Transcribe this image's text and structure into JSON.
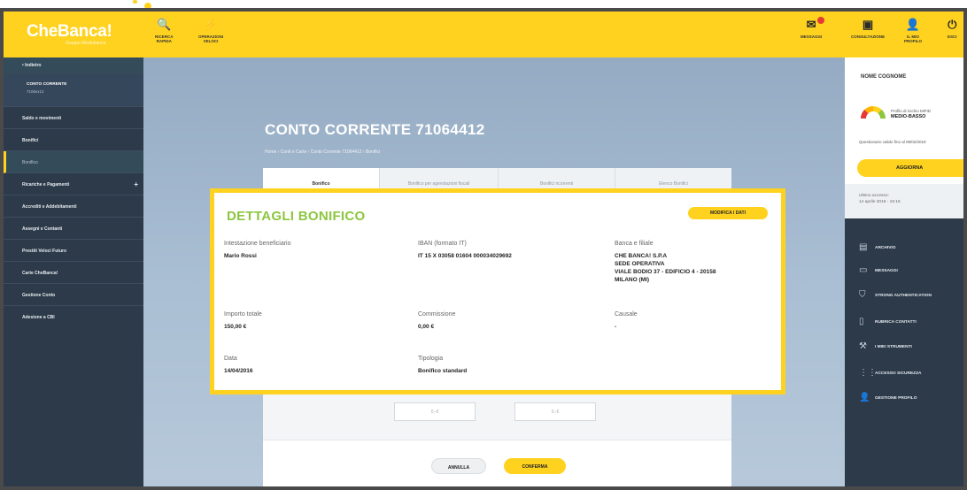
{
  "header": {
    "logo": "CheBanca!",
    "logo_sub": "Gruppo Mediobanca",
    "left_buttons": [
      {
        "icon": "search-icon",
        "glyph": "🔍",
        "label1": "RICERCA",
        "label2": "RAPIDA"
      },
      {
        "icon": "lightning-icon",
        "glyph": "⚡",
        "label1": "OPERAZIONI",
        "label2": "VELOCI"
      }
    ],
    "right_buttons": [
      {
        "icon": "mail-icon",
        "glyph": "✉",
        "label1": "MESSAGGI",
        "label2": ""
      },
      {
        "icon": "book-icon",
        "glyph": "▣",
        "label1": "CONSULTAZIONE",
        "label2": ""
      },
      {
        "icon": "user-icon",
        "glyph": "👤",
        "label1": "IL MIO",
        "label2": "PROFILO"
      },
      {
        "icon": "exit-icon",
        "glyph": "⏻",
        "label1": "ESCI",
        "label2": ""
      }
    ]
  },
  "sidebar": {
    "home": "• Indietro",
    "account": "CONTO CORRENTE",
    "account_sub": "7106xx12",
    "items": [
      "Saldo e movimenti",
      "Bonifici",
      "Bonifico",
      "Ricariche e Pagamenti",
      "Accrediti e Addebitamenti",
      "Assegni e Contanti",
      "Prestiti Veloci Futuro",
      "Carte CheBanca!",
      "Gestione Conto",
      "Adesione a CBI"
    ],
    "expand_glyph": "+"
  },
  "main": {
    "title": "CONTO CORRENTE 71064412",
    "breadcrumb": "Home  ›  Conti e Carte  ›  Conto Corrente 71064412  ›  Bonifici",
    "tabs": [
      "Bonifico",
      "Bonifico per agevolazioni fiscali",
      "Bonifici ricorrenti",
      "Elenco Bonifici"
    ],
    "field_a": "0,-€",
    "field_b": "0,-€",
    "cancel": "ANNULLA",
    "confirm": "CONFERMA"
  },
  "detail": {
    "title": "DETTAGLI BONIFICO",
    "edit": "MODIFICA I DATI",
    "beneficiary_label": "Intestazione beneficiario",
    "beneficiary_value": "Mario Rossi",
    "iban_label": "IBAN (formato IT)",
    "iban_value": "IT 15 X 03058 01604 000034029692",
    "bank_label": "Banca e filiale",
    "bank_value_lines": [
      "CHE BANCA! S.P.A",
      "SEDE OPERATIVA",
      "VIALE BODIO 37 - EDIFICIO 4 - 20158",
      "MILANO (MI)"
    ],
    "amount_label": "Importo totale",
    "amount_value": "150,00 €",
    "fee_label": "Commissione",
    "fee_value": "0,00 €",
    "reason_label": "Causale",
    "reason_value": "-",
    "date_label": "Data",
    "date_value": "14/04/2016",
    "type_label": "Tipologia",
    "type_value": "Bonifico standard"
  },
  "right_panel": {
    "name": "NOME COGNOME",
    "profile_label": "Profilo di rischio MiFID",
    "profile_value": "MEDIO-BASSO",
    "valid_until": "Questionario valido fino al 09/02/2019",
    "update": "AGGIORNA",
    "last_access_label": "Ultimo accesso:",
    "last_access_value": "14 aprile 2016 - 15:16",
    "items": [
      {
        "icon": "archive-icon",
        "glyph": "▤",
        "label": "ARCHIVIO"
      },
      {
        "icon": "messages-icon",
        "glyph": "▭",
        "label": "MESSAGGI"
      },
      {
        "icon": "shield-icon",
        "glyph": "⛉",
        "label": "STRONG AUTHENTICATION"
      },
      {
        "icon": "contacts-icon",
        "glyph": "▯",
        "label": "RUBRICA CONTATTI"
      },
      {
        "icon": "wrench-icon",
        "glyph": "⚒",
        "label": "I MIEI STRUMENTI"
      },
      {
        "icon": "security-icon",
        "glyph": "⋮⋮",
        "label": "ACCESSO SICUREZZA"
      },
      {
        "icon": "user-icon",
        "glyph": "👤",
        "label": "GESTIONE PROFILO"
      }
    ]
  }
}
